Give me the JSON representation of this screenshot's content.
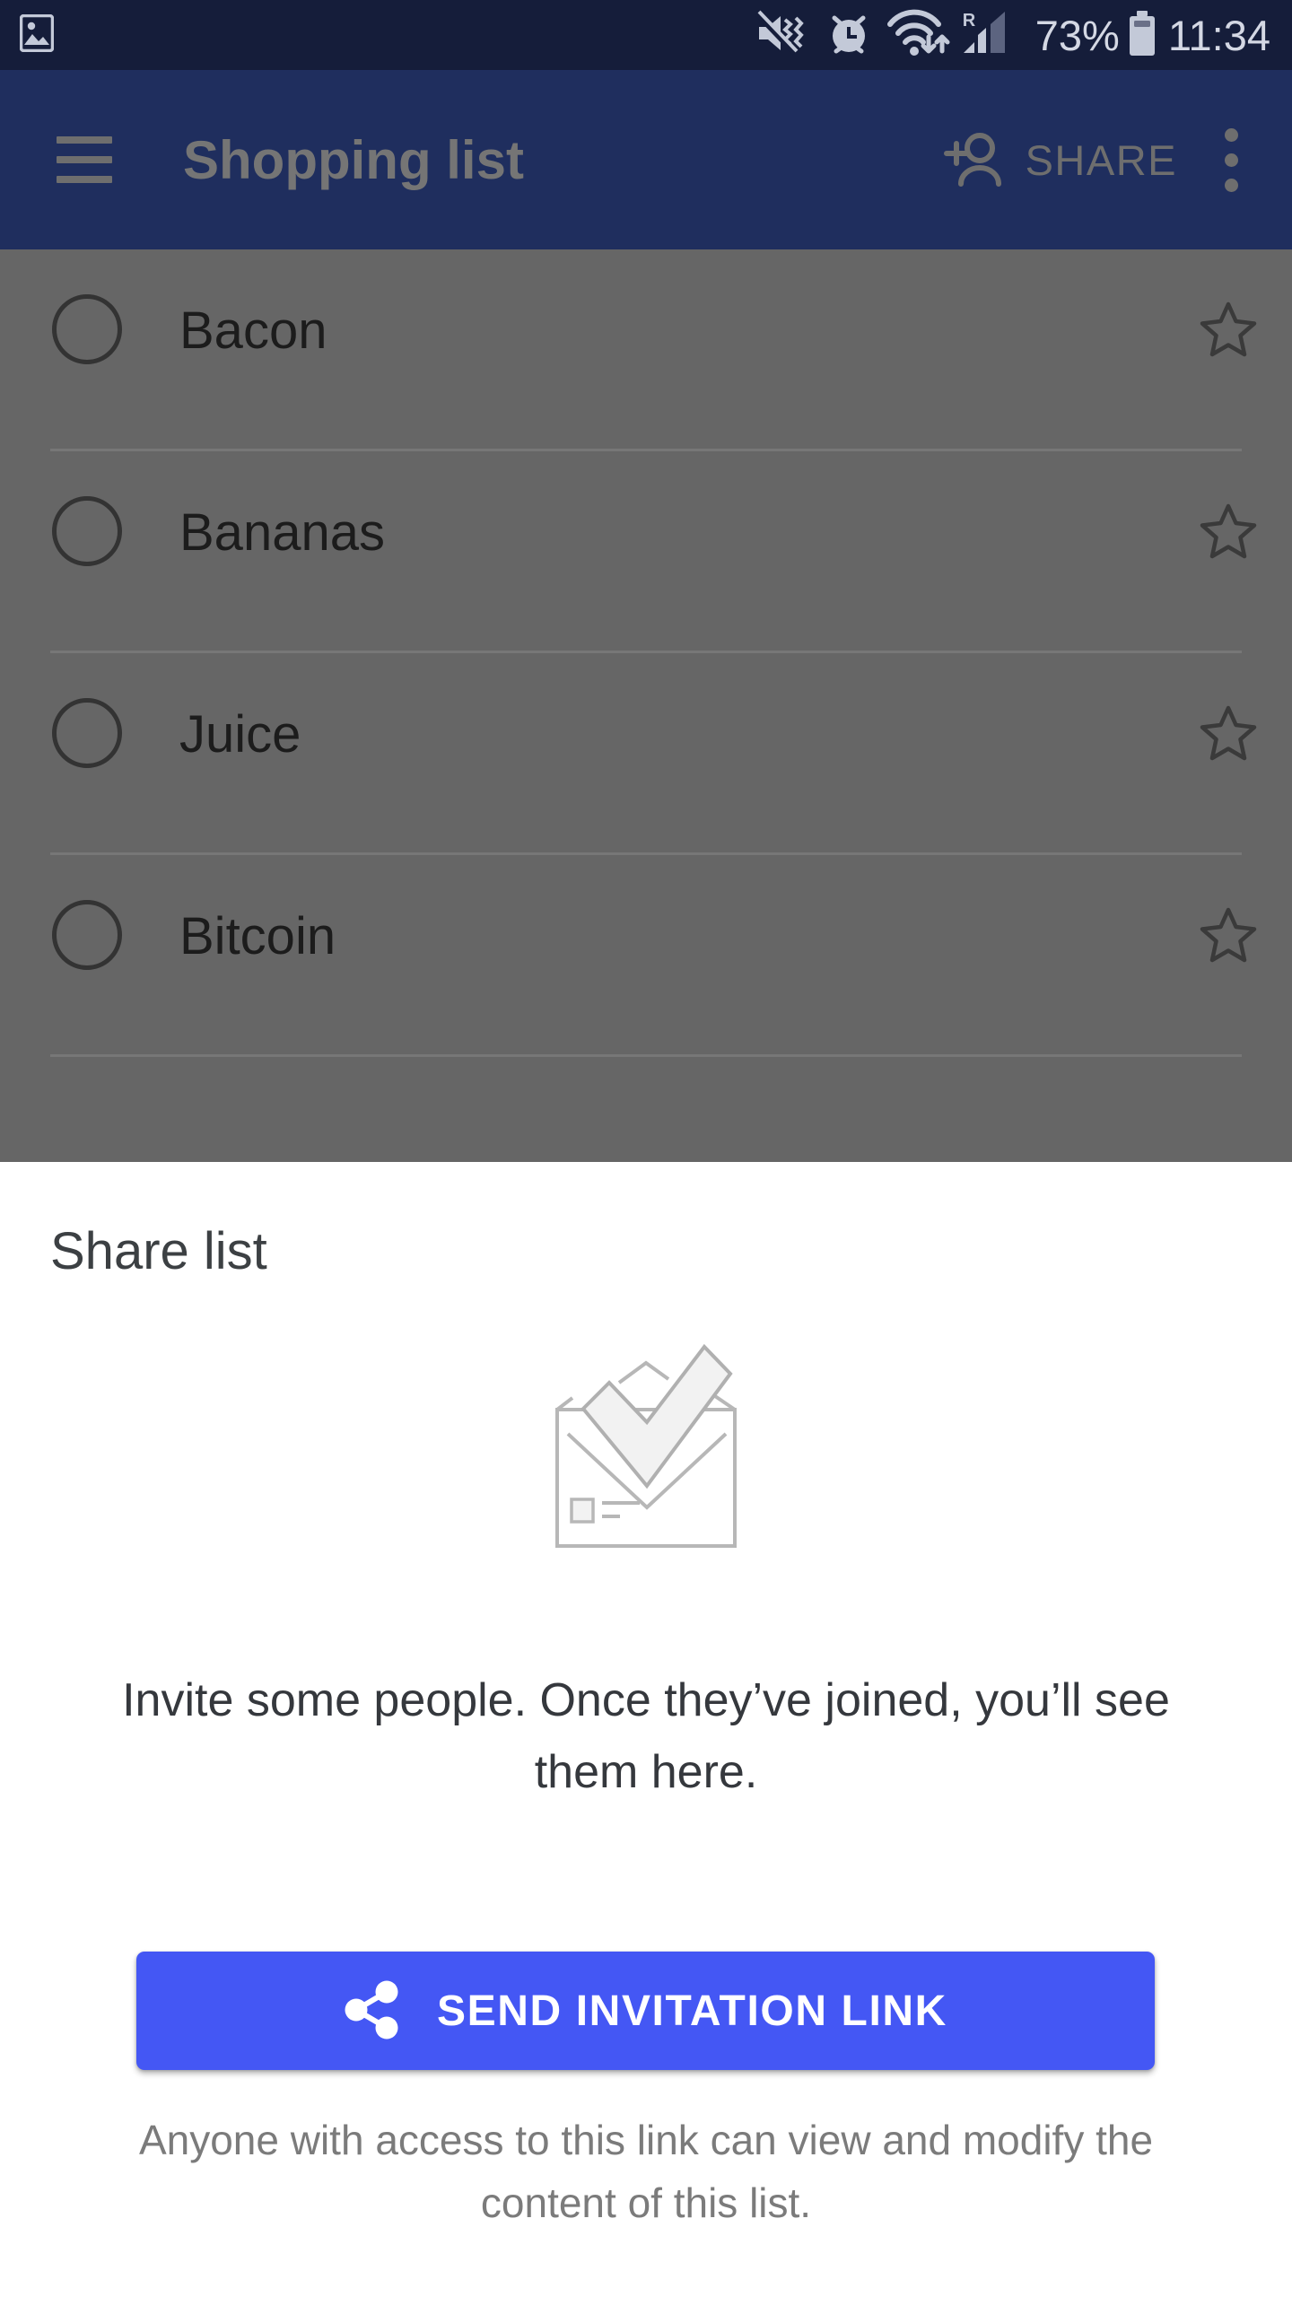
{
  "status_bar": {
    "background_color": "#151d3a",
    "icons": [
      "mute-vibrate-icon",
      "alarm-clock-icon",
      "wifi-data-transfer-icon",
      "roaming-signal-icon"
    ],
    "roaming_label": "R",
    "battery_percent": "73%",
    "battery_icon": "battery-icon",
    "clock": "11:34",
    "left_icon": "gallery-image-icon"
  },
  "app_bar": {
    "background_color": "#1f2e5e",
    "menu_icon": "hamburger-menu-icon",
    "title": "Shopping list",
    "share_icon": "person-add-icon",
    "share_label": "SHARE",
    "overflow_icon": "more-vertical-icon"
  },
  "list": {
    "scrim_color": "#666666",
    "items": [
      {
        "label": "Bacon",
        "checked": false,
        "starred": false
      },
      {
        "label": "Bananas",
        "checked": false,
        "starred": false
      },
      {
        "label": "Juice",
        "checked": false,
        "starred": false
      },
      {
        "label": "Bitcoin",
        "checked": false,
        "starred": false
      }
    ]
  },
  "share_sheet": {
    "title": "Share list",
    "illustration": "envelope-with-checkmark-illustration",
    "empty_state_text": "Invite some people. Once they’ve joined, you’ll see them here.",
    "button": {
      "label": "SEND INVITATION LINK",
      "icon": "share-nodes-icon",
      "color": "#4457f4"
    },
    "footnote": "Anyone with access to this link can view and modify the content of this list."
  }
}
